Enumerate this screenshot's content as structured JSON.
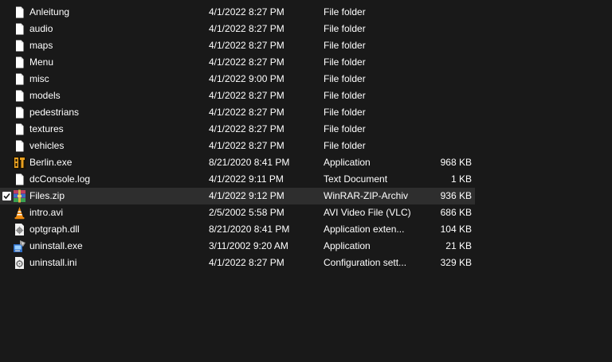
{
  "files": [
    {
      "name": "Anleitung",
      "date": "4/1/2022 8:27 PM",
      "type": "File folder",
      "size": "",
      "icon": "document-icon",
      "selected": false
    },
    {
      "name": "audio",
      "date": "4/1/2022 8:27 PM",
      "type": "File folder",
      "size": "",
      "icon": "document-icon",
      "selected": false
    },
    {
      "name": "maps",
      "date": "4/1/2022 8:27 PM",
      "type": "File folder",
      "size": "",
      "icon": "document-icon",
      "selected": false
    },
    {
      "name": "Menu",
      "date": "4/1/2022 8:27 PM",
      "type": "File folder",
      "size": "",
      "icon": "document-icon",
      "selected": false
    },
    {
      "name": "misc",
      "date": "4/1/2022 9:00 PM",
      "type": "File folder",
      "size": "",
      "icon": "document-icon",
      "selected": false
    },
    {
      "name": "models",
      "date": "4/1/2022 8:27 PM",
      "type": "File folder",
      "size": "",
      "icon": "document-icon",
      "selected": false
    },
    {
      "name": "pedestrians",
      "date": "4/1/2022 8:27 PM",
      "type": "File folder",
      "size": "",
      "icon": "document-icon",
      "selected": false
    },
    {
      "name": "textures",
      "date": "4/1/2022 8:27 PM",
      "type": "File folder",
      "size": "",
      "icon": "document-icon",
      "selected": false
    },
    {
      "name": "vehicles",
      "date": "4/1/2022 8:27 PM",
      "type": "File folder",
      "size": "",
      "icon": "document-icon",
      "selected": false
    },
    {
      "name": "Berlin.exe",
      "date": "8/21/2020 8:41 PM",
      "type": "Application",
      "size": "968 KB",
      "icon": "berlin-app-icon",
      "selected": false
    },
    {
      "name": "dcConsole.log",
      "date": "4/1/2022 9:11 PM",
      "type": "Text Document",
      "size": "1 KB",
      "icon": "document-icon",
      "selected": false
    },
    {
      "name": "Files.zip",
      "date": "4/1/2022 9:12 PM",
      "type": "WinRAR-ZIP-Archiv",
      "size": "936 KB",
      "icon": "winrar-archive-icon",
      "selected": true
    },
    {
      "name": "intro.avi",
      "date": "2/5/2002 5:58 PM",
      "type": "AVI Video File (VLC)",
      "size": "686 KB",
      "icon": "vlc-cone-icon",
      "selected": false
    },
    {
      "name": "optgraph.dll",
      "date": "8/21/2020 8:41 PM",
      "type": "Application exten...",
      "size": "104 KB",
      "icon": "dll-gear-icon",
      "selected": false
    },
    {
      "name": "uninstall.exe",
      "date": "3/11/2002 9:20 AM",
      "type": "Application",
      "size": "21 KB",
      "icon": "uninstaller-icon",
      "selected": false
    },
    {
      "name": "uninstall.ini",
      "date": "4/1/2022 8:27 PM",
      "type": "Configuration sett...",
      "size": "329 KB",
      "icon": "ini-settings-icon",
      "selected": false
    }
  ],
  "colors": {
    "background": "#191919",
    "selected_row": "#2e2e2e",
    "text": "#ffffff"
  }
}
